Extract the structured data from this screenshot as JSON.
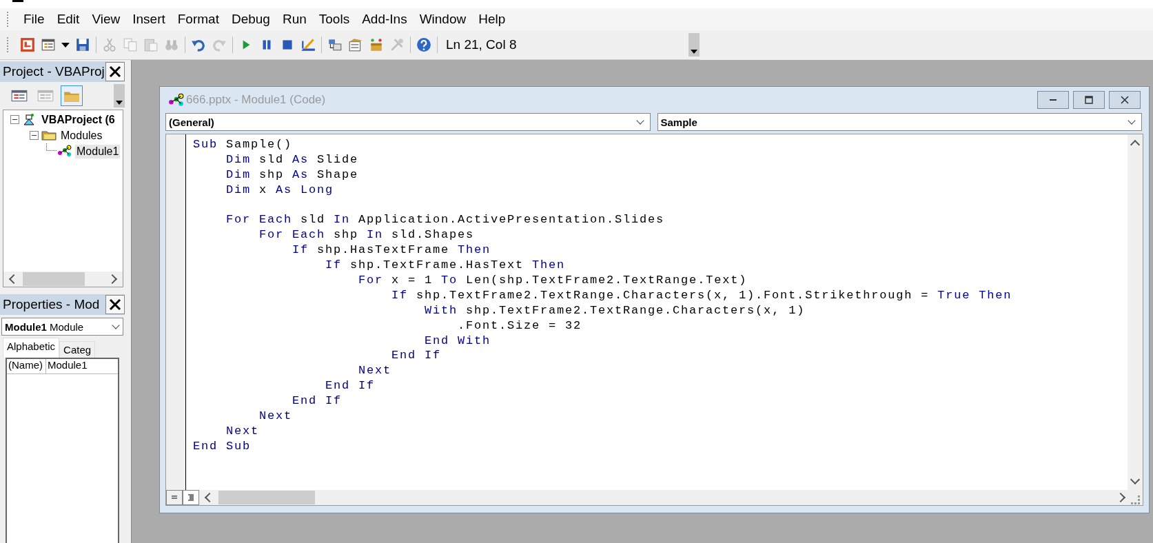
{
  "menu": [
    {
      "label": "File"
    },
    {
      "label": "Edit"
    },
    {
      "label": "View"
    },
    {
      "label": "Insert"
    },
    {
      "label": "Format"
    },
    {
      "label": "Debug"
    },
    {
      "label": "Run"
    },
    {
      "label": "Tools"
    },
    {
      "label": "Add-Ins"
    },
    {
      "label": "Window"
    },
    {
      "label": "Help"
    }
  ],
  "toolbar": {
    "groups": [
      [
        {
          "kind": "app",
          "disabled": false
        },
        {
          "kind": "insert-form",
          "disabled": false
        },
        {
          "kind": "save",
          "disabled": false
        }
      ],
      [
        {
          "kind": "cut",
          "disabled": true
        },
        {
          "kind": "copy",
          "disabled": true
        },
        {
          "kind": "paste",
          "disabled": true
        },
        {
          "kind": "find",
          "disabled": true
        }
      ],
      [
        {
          "kind": "undo",
          "disabled": false
        },
        {
          "kind": "redo",
          "disabled": true
        }
      ],
      [
        {
          "kind": "run",
          "disabled": false
        },
        {
          "kind": "pause",
          "disabled": false
        },
        {
          "kind": "stop",
          "disabled": false
        },
        {
          "kind": "design",
          "disabled": false
        }
      ],
      [
        {
          "kind": "explorer",
          "disabled": false
        },
        {
          "kind": "properties",
          "disabled": false
        },
        {
          "kind": "browser",
          "disabled": false
        },
        {
          "kind": "toolbox",
          "disabled": true
        }
      ],
      [
        {
          "kind": "help",
          "disabled": false
        }
      ]
    ],
    "position": "Ln 21, Col 8"
  },
  "project": {
    "title": "Project - VBAProj",
    "buttons": [
      {
        "kind": "view-code",
        "selected": false,
        "disabled": false
      },
      {
        "kind": "view-object",
        "selected": false,
        "disabled": true
      },
      {
        "kind": "toggle-folders",
        "selected": true,
        "disabled": false
      }
    ],
    "tree": [
      {
        "label": "VBAProject (6",
        "kind": "project",
        "expanded": true,
        "selected": false,
        "children": [
          {
            "label": "Modules",
            "kind": "folder",
            "expanded": true,
            "selected": false,
            "children": [
              {
                "label": "Module1",
                "kind": "module",
                "selected": true
              }
            ]
          }
        ]
      }
    ]
  },
  "properties": {
    "title": "Properties - Mod",
    "object_name": "Module1",
    "object_type": "Module",
    "tabs": [
      {
        "label": "Alphabetic",
        "selected": true
      },
      {
        "label": "Categ",
        "selected": false
      }
    ],
    "rows": [
      {
        "name": "(Name)",
        "value": "Module1"
      }
    ]
  },
  "code_window": {
    "title": "666.pptx - Module1 (Code)",
    "active": false,
    "object": "(General)",
    "procedure": "Sample",
    "lines": [
      {
        "kind": "code",
        "tokens": [
          {
            "text": "Sub",
            "keyword": true
          },
          {
            "text": " Sample()",
            "keyword": false
          }
        ]
      },
      {
        "kind": "code",
        "tokens": [
          {
            "text": "    Dim",
            "keyword": true
          },
          {
            "text": " sld ",
            "keyword": false
          },
          {
            "text": "As",
            "keyword": true
          },
          {
            "text": " Slide",
            "keyword": false
          }
        ]
      },
      {
        "kind": "code",
        "tokens": [
          {
            "text": "    Dim",
            "keyword": true
          },
          {
            "text": " shp ",
            "keyword": false
          },
          {
            "text": "As",
            "keyword": true
          },
          {
            "text": " Shape",
            "keyword": false
          }
        ]
      },
      {
        "kind": "code",
        "tokens": [
          {
            "text": "    Dim",
            "keyword": true
          },
          {
            "text": " x ",
            "keyword": false
          },
          {
            "text": "As Long",
            "keyword": true
          }
        ]
      },
      {
        "kind": "blank"
      },
      {
        "kind": "code",
        "tokens": [
          {
            "text": "    For Each",
            "keyword": true
          },
          {
            "text": " sld ",
            "keyword": false
          },
          {
            "text": "In",
            "keyword": true
          },
          {
            "text": " Application.ActivePresentation.Slides",
            "keyword": false
          }
        ]
      },
      {
        "kind": "code",
        "tokens": [
          {
            "text": "        For Each",
            "keyword": true
          },
          {
            "text": " shp ",
            "keyword": false
          },
          {
            "text": "In",
            "keyword": true
          },
          {
            "text": " sld.Shapes",
            "keyword": false
          }
        ]
      },
      {
        "kind": "code",
        "tokens": [
          {
            "text": "            If",
            "keyword": true
          },
          {
            "text": " shp.HasTextFrame ",
            "keyword": false
          },
          {
            "text": "Then",
            "keyword": true
          }
        ]
      },
      {
        "kind": "code",
        "tokens": [
          {
            "text": "                If",
            "keyword": true
          },
          {
            "text": " shp.TextFrame.HasText ",
            "keyword": false
          },
          {
            "text": "Then",
            "keyword": true
          }
        ]
      },
      {
        "kind": "code",
        "tokens": [
          {
            "text": "                    For",
            "keyword": true
          },
          {
            "text": " x = 1 ",
            "keyword": false
          },
          {
            "text": "To",
            "keyword": true
          },
          {
            "text": " Len(shp.TextFrame2.TextRange.Text)",
            "keyword": false
          }
        ]
      },
      {
        "kind": "code",
        "tokens": [
          {
            "text": "                        If",
            "keyword": true
          },
          {
            "text": " shp.TextFrame2.TextRange.Characters(x, 1).Font.Strikethrough = ",
            "keyword": false
          },
          {
            "text": "True Then",
            "keyword": true
          }
        ]
      },
      {
        "kind": "code",
        "tokens": [
          {
            "text": "                            With",
            "keyword": true
          },
          {
            "text": " shp.TextFrame2.TextRange.Characters(x, 1)",
            "keyword": false
          }
        ]
      },
      {
        "kind": "code",
        "tokens": [
          {
            "text": "                                .Font.Size = 32",
            "keyword": false
          }
        ]
      },
      {
        "kind": "code",
        "tokens": [
          {
            "text": "                            End With",
            "keyword": true
          }
        ]
      },
      {
        "kind": "code",
        "tokens": [
          {
            "text": "                        End If",
            "keyword": true
          }
        ]
      },
      {
        "kind": "code",
        "tokens": [
          {
            "text": "                    Next",
            "keyword": true
          }
        ]
      },
      {
        "kind": "code",
        "tokens": [
          {
            "text": "                End If",
            "keyword": true
          }
        ]
      },
      {
        "kind": "code",
        "tokens": [
          {
            "text": "            End If",
            "keyword": true
          }
        ]
      },
      {
        "kind": "code",
        "tokens": [
          {
            "text": "        Next",
            "keyword": true
          }
        ]
      },
      {
        "kind": "code",
        "tokens": [
          {
            "text": "    Next",
            "keyword": true
          }
        ]
      },
      {
        "kind": "code",
        "tokens": [
          {
            "text": "End Sub",
            "keyword": true
          }
        ]
      }
    ]
  }
}
